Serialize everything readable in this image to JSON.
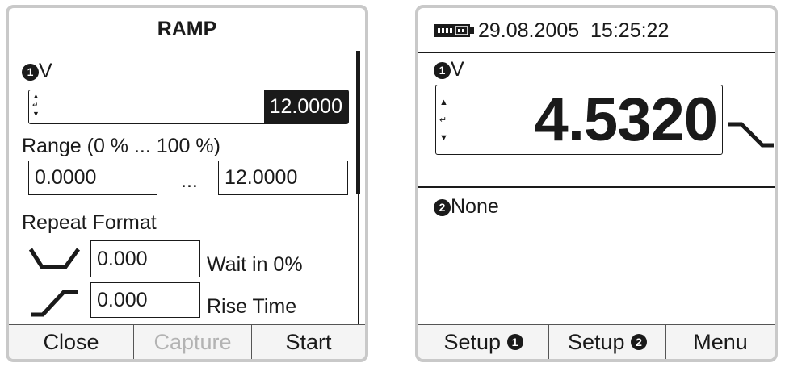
{
  "left": {
    "title": "RAMP",
    "channel_number": "1",
    "channel_unit": "V",
    "value": "12.0000",
    "range_label": "Range (0 % ... 100 %)",
    "range_low": "0.0000",
    "range_sep": "...",
    "range_high": "12.0000",
    "repeat_label": "Repeat Format",
    "wait_value": "0.000",
    "wait_label": "Wait in 0%",
    "rise_value": "0.000",
    "rise_label": "Rise Time",
    "softkeys": {
      "close": "Close",
      "capture": "Capture",
      "start": "Start"
    }
  },
  "right": {
    "date": "29.08.2005",
    "time": "15:25:22",
    "channel1_number": "1",
    "channel1_unit": "V",
    "reading": "4.5320",
    "channel2_number": "2",
    "channel2_value": "None",
    "softkeys": {
      "setup1": "Setup",
      "setup1_num": "1",
      "setup2": "Setup",
      "setup2_num": "2",
      "menu": "Menu"
    }
  },
  "colors": {
    "text": "#1a1a1a",
    "disabled": "#b3b3b3",
    "bezel": "#c9c9c9",
    "softkey_bg": "#f4f4f4"
  },
  "icons": [
    "battery-icon",
    "spin-arrows-icon",
    "wait-ramp-icon",
    "rise-ramp-icon",
    "trend-down-icon"
  ]
}
